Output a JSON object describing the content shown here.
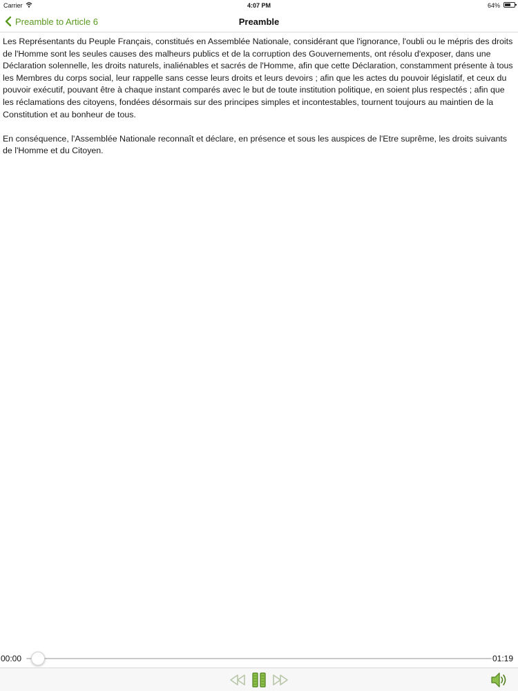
{
  "status_bar": {
    "carrier": "Carrier",
    "time": "4:07 PM",
    "battery": "64%",
    "battery_level": 0.64
  },
  "nav": {
    "back_label": "Preamble to Article 6",
    "title": "Preamble"
  },
  "content": {
    "paragraphs": [
      "Les Représentants du Peuple Français, constitués en Assemblée Nationale, considérant que l'ignorance, l'oubli ou le mépris des droits de l'Homme sont les seules causes des malheurs publics et de la corruption des Gouvernements, ont résolu d'exposer, dans une Déclaration solennelle, les droits naturels, inaliénables et sacrés de l'Homme, afin que cette Déclaration, constamment présente à tous les Membres du corps social, leur rappelle sans cesse leurs droits et leurs devoirs ; afin que les actes du pouvoir législatif, et ceux du pouvoir exécutif, pouvant être à chaque instant comparés avec le but de toute institution politique, en soient plus respectés ; afin que les réclamations des citoyens, fondées désormais sur des principes simples et incontestables, tournent toujours au maintien de la Constitution et au bonheur de tous.",
      "En conséquence, l'Assemblée Nationale reconnaît et déclare, en présence et sous les auspices de l'Etre suprême, les droits suivants de l'Homme et du Citoyen."
    ]
  },
  "player": {
    "elapsed": "00:00",
    "total": "01:19",
    "progress": 0.0,
    "accent_color": "#7fb13a"
  },
  "toolbar": {
    "icons": [
      "rewind-icon",
      "pause-icon",
      "fast-forward-icon",
      "volume-icon"
    ]
  },
  "colors": {
    "accent": "#5a9a1f",
    "accent_light": "#7fb13a"
  }
}
